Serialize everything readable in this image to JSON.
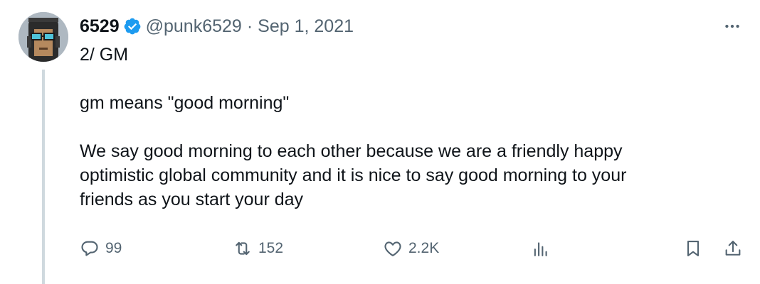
{
  "author": {
    "display_name": "6529",
    "handle": "@punk6529",
    "separator": "·",
    "date": "Sep 1, 2021",
    "verified": true,
    "avatar": "pixel-punk-avatar"
  },
  "tweet": {
    "lines": [
      "2/ GM",
      "",
      "gm means \"good morning\"",
      "",
      "We say good morning to each other because we are a friendly happy",
      "optimistic global community and it is nice to say good morning to your",
      "friends as you start your day"
    ]
  },
  "actions": {
    "replies": {
      "icon": "reply-icon",
      "count": "99"
    },
    "retweets": {
      "icon": "retweet-icon",
      "count": "152"
    },
    "likes": {
      "icon": "heart-icon",
      "count": "2.2K"
    },
    "views": {
      "icon": "analytics-icon"
    },
    "bookmark": {
      "icon": "bookmark-icon"
    },
    "share": {
      "icon": "share-icon"
    }
  },
  "more": {
    "icon": "more-dots-icon"
  },
  "colors": {
    "text": "#0f1419",
    "secondary": "#536471",
    "verified": "#1d9bf0",
    "thread_line": "#cfd9de"
  }
}
